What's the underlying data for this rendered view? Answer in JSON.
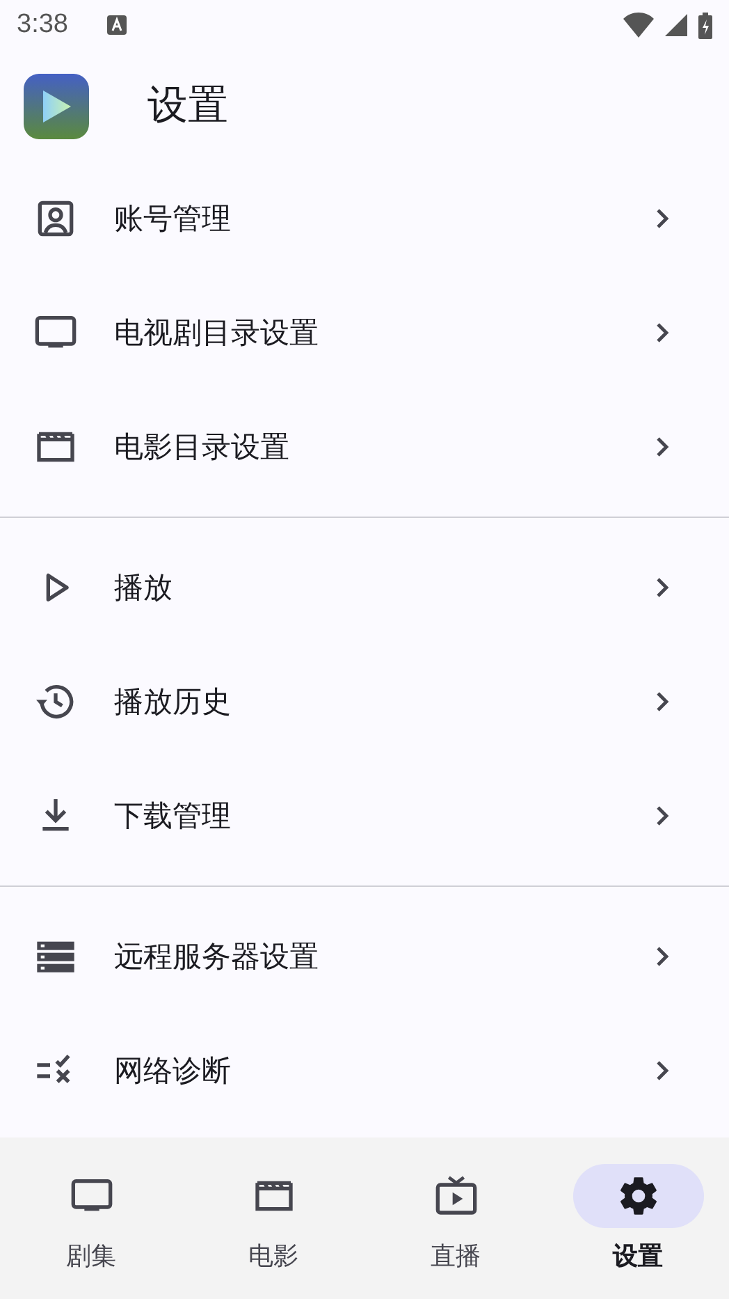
{
  "status_bar": {
    "time": "3:38"
  },
  "header": {
    "title": "设置"
  },
  "sections": [
    {
      "items": [
        {
          "label": "账号管理"
        },
        {
          "label": "电视剧目录设置"
        },
        {
          "label": "电影目录设置"
        }
      ]
    },
    {
      "items": [
        {
          "label": "播放"
        },
        {
          "label": "播放历史"
        },
        {
          "label": "下载管理"
        }
      ]
    },
    {
      "items": [
        {
          "label": "远程服务器设置"
        },
        {
          "label": "网络诊断"
        }
      ]
    }
  ],
  "bottom_nav": [
    {
      "label": "剧集",
      "selected": false
    },
    {
      "label": "电影",
      "selected": false
    },
    {
      "label": "直播",
      "selected": false
    },
    {
      "label": "设置",
      "selected": true
    }
  ]
}
